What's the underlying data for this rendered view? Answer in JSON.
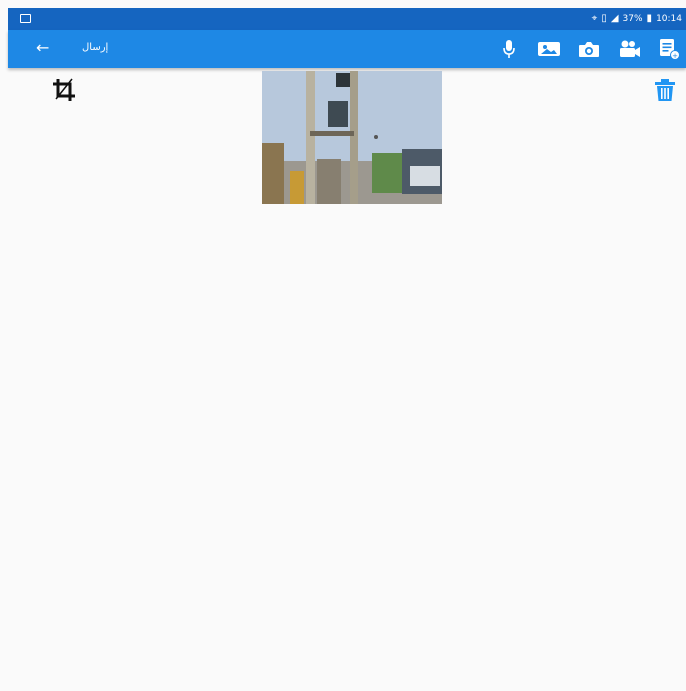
{
  "status_bar": {
    "icons": [
      "notification-icon",
      "location-icon",
      "vibrate-icon",
      "signal-icon",
      "battery-icon"
    ],
    "battery": "37%",
    "time": "10:14"
  },
  "app_bar": {
    "title": "إرسال",
    "back_icon": "arrow-back-icon",
    "actions": [
      "microphone-icon",
      "gallery-icon",
      "camera-icon",
      "video-camera-icon",
      "attach-document-icon"
    ]
  },
  "editor": {
    "crop_icon": "crop-icon",
    "delete_icon": "trash-icon",
    "image": "street-pole-photo"
  },
  "colors": {
    "status_bar": "#1565c0",
    "app_bar": "#1e88e5",
    "background": "#fafafa",
    "trash": "#2196f3"
  }
}
